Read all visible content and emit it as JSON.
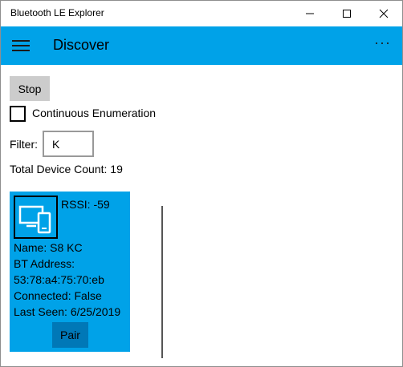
{
  "window": {
    "title": "Bluetooth LE Explorer"
  },
  "header": {
    "title": "Discover",
    "more_label": "···"
  },
  "controls": {
    "stop_label": "Stop",
    "continuous_label": "Continuous Enumeration",
    "continuous_checked": false,
    "filter_label": "Filter:",
    "filter_value": "K",
    "total_count_text": "Total Device Count: 19"
  },
  "device": {
    "rssi": "RSSI: -59",
    "name": "Name: S8 KC",
    "bt_address_label": "BT Address:",
    "bt_address": "53:78:a4:75:70:eb",
    "connected": "Connected: False",
    "last_seen": "Last Seen: 6/25/2019",
    "pair_label": "Pair",
    "icon": "devices-icon"
  },
  "colors": {
    "accent": "#00a2e8",
    "pair_button": "#0078b7",
    "stop_button": "#cccccc"
  }
}
